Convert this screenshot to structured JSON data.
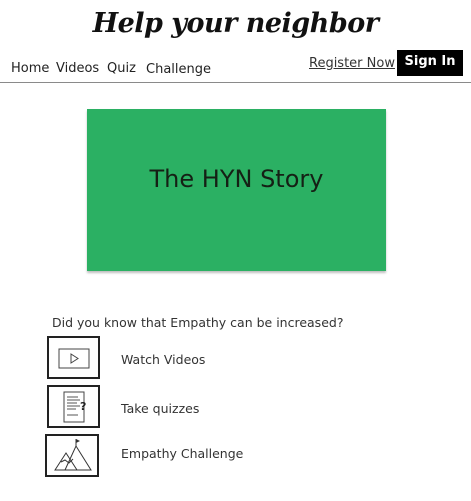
{
  "brand": {
    "title": "Help your neighbor"
  },
  "nav": {
    "items": [
      "Home",
      "Videos",
      "Quiz",
      "Challenge"
    ],
    "register": "Register Now",
    "sign_in": "Sign In"
  },
  "hero": {
    "title": "The HYN Story",
    "color": "#2bb063"
  },
  "intro": {
    "question": "Did you know that Empathy can be increased?"
  },
  "features": [
    {
      "label": "Watch Videos",
      "icon": "play-icon"
    },
    {
      "label": "Take quizzes",
      "icon": "quiz-document-icon"
    },
    {
      "label": "Empathy Challenge",
      "icon": "mountain-flag-icon"
    }
  ]
}
